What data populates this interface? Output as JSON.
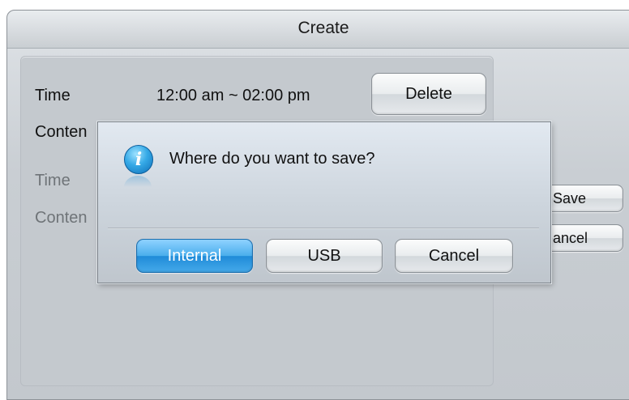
{
  "window": {
    "title": "Create"
  },
  "schedule": {
    "time_label": "Time",
    "time_value": "12:00 am ~ 02:00 pm",
    "delete_label": "Delete",
    "content_label": "Conten",
    "time_label_2": "Time",
    "content_label_2": "Conten"
  },
  "side": {
    "save_label": "Save",
    "cancel_label": "ancel"
  },
  "dialog": {
    "message": "Where do you want to save?",
    "icon": "info-icon",
    "buttons": {
      "internal": "Internal",
      "usb": "USB",
      "cancel": "Cancel"
    }
  },
  "colors": {
    "accent": "#2a95dd",
    "primary_button": "#3aa3e6"
  }
}
